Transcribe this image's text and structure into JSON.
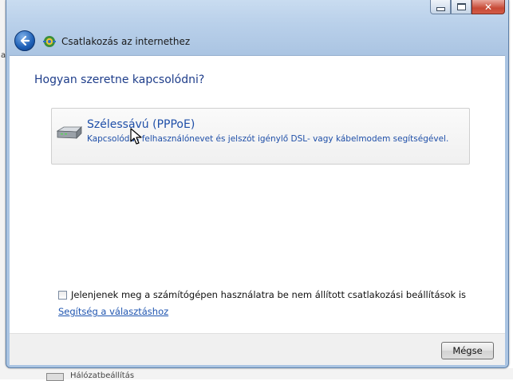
{
  "window": {
    "title": "Csatlakozás az internethez",
    "buttons": {
      "minimize": "",
      "maximize": "",
      "close": "✕"
    }
  },
  "nav": {
    "back_icon": "back-arrow-icon",
    "app_icon": "network-connection-icon"
  },
  "content": {
    "question": "Hogyan szeretne kapcsolódni?",
    "option": {
      "icon": "broadband-modem-icon",
      "title": "Szélessávú (PPPoE)",
      "description": "Kapcsolódás felhasználónevet és jelszót igénylő DSL- vagy kábelmodem segítségével."
    },
    "show_unconfigured_label": "Jelenjenek meg a számítógépen használatra be nem állított csatlakozási beállítások is",
    "help_link": "Segítség a választáshoz"
  },
  "footer": {
    "cancel_label": "Mégse"
  },
  "background": {
    "left_letter": "a",
    "bottom_text": "Hálózatbeállítás"
  }
}
